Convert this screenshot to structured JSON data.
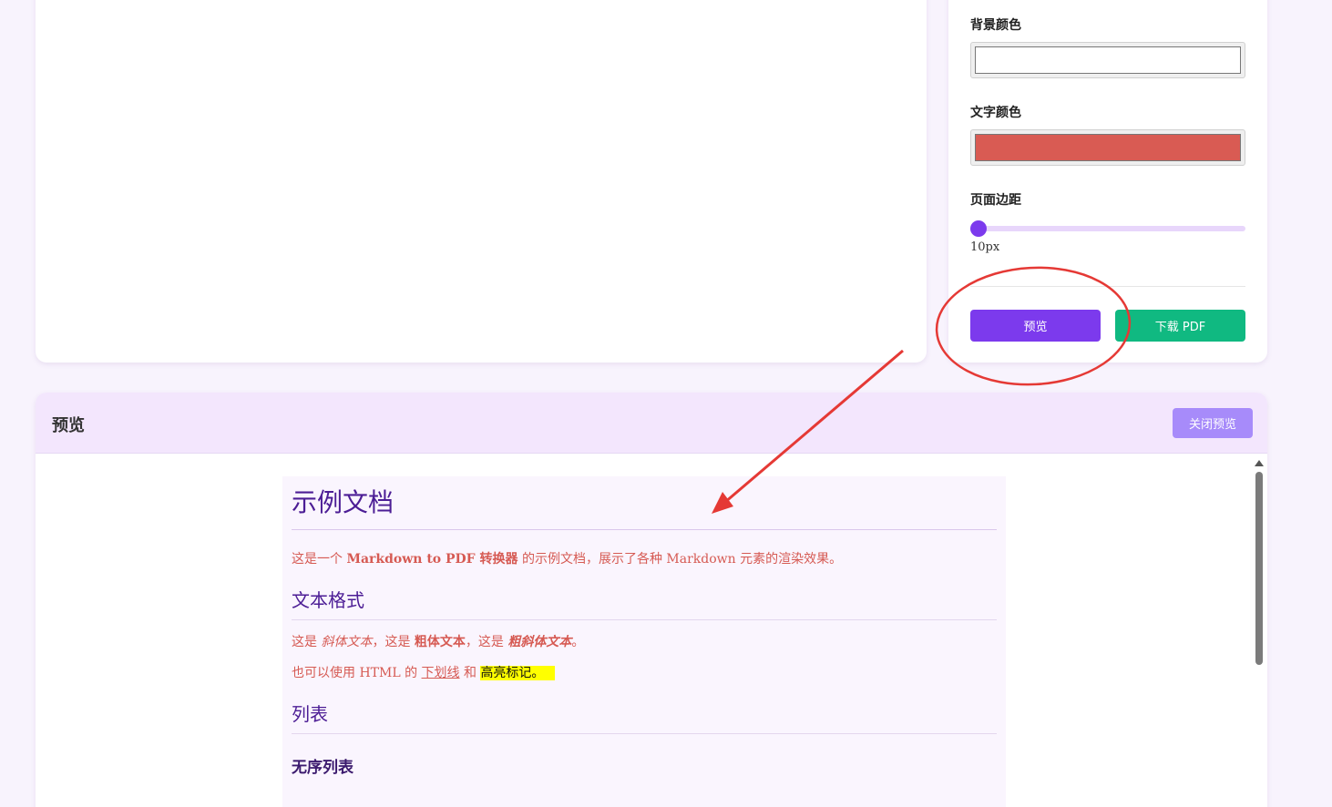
{
  "settings": {
    "bg_color_label": "背景颜色",
    "bg_color_value": "#ffffff",
    "text_color_label": "文字颜色",
    "text_color_value": "#d95b53",
    "margin_label": "页面边距",
    "margin_value": "10px",
    "preview_button": "预览",
    "download_button": "下载 PDF"
  },
  "preview": {
    "title": "预览",
    "close_button": "关闭预览",
    "doc": {
      "h1": "示例文档",
      "intro_a": "这是一个 ",
      "intro_bold": "Markdown to PDF 转换器",
      "intro_b": " 的示例文档，展示了各种 Markdown 元素的渲染效果。",
      "h2_format": "文本格式",
      "fmt_a": "这是 ",
      "fmt_italic": "斜体文本",
      "fmt_b": "，这是 ",
      "fmt_bold": "粗体文本",
      "fmt_c": "，这是 ",
      "fmt_bold_italic": "粗斜体文本",
      "fmt_d": "。",
      "html_a": "也可以使用 HTML 的 ",
      "html_underline": "下划线",
      "html_b": " 和 ",
      "html_mark": "高亮标记。",
      "h2_list": "列表",
      "h3_unordered": "无序列表"
    }
  },
  "colors": {
    "accent": "#7c3aed",
    "download": "#10b981",
    "annotation": "#e53935"
  }
}
